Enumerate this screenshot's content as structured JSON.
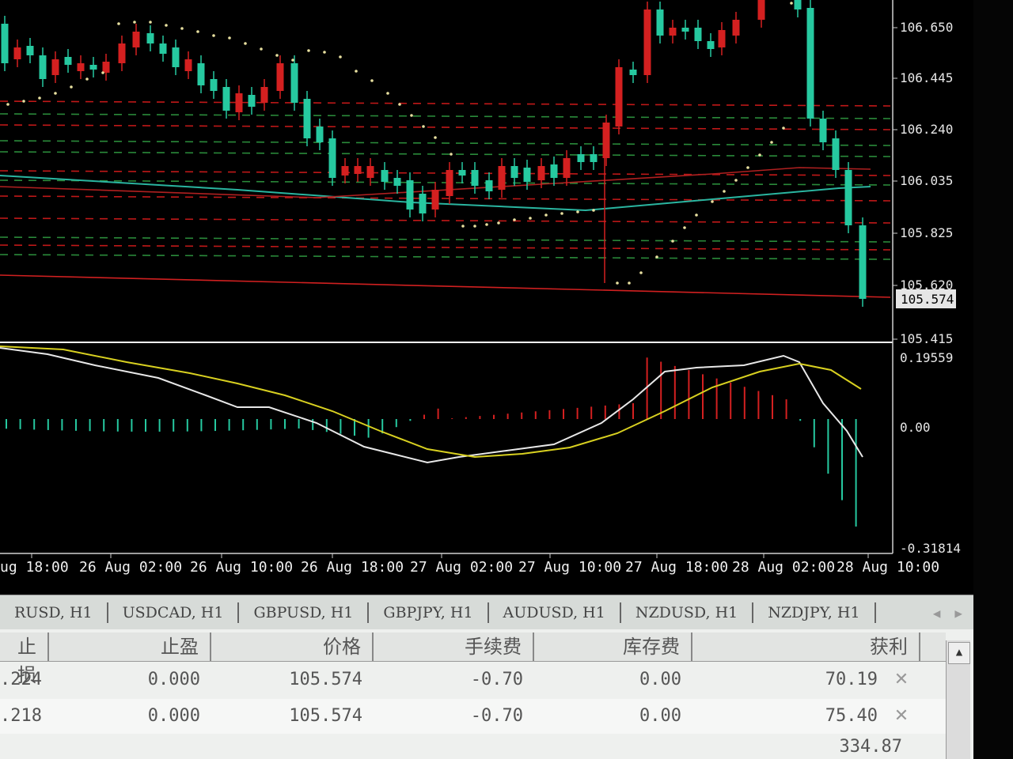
{
  "chart": {
    "price_axis": [
      "106.650",
      "106.445",
      "106.240",
      "106.035",
      "105.825",
      "105.620",
      "105.415"
    ],
    "current_price": "105.574",
    "macd_axis": [
      "0.19559",
      "0.00",
      "-0.31814"
    ],
    "time_axis": [
      "ug 18:00",
      "26 Aug 02:00",
      "26 Aug 10:00",
      "26 Aug 18:00",
      "27 Aug 02:00",
      "27 Aug 10:00",
      "27 Aug 18:00",
      "28 Aug 02:00",
      "28 Aug 10:00"
    ],
    "colors": {
      "bull": "#26c9a0",
      "bear": "#d42020",
      "macd_main": "#e8e8e8",
      "macd_signal": "#d8d020",
      "sar": "#e8e0a0",
      "grid_red": "#c01818",
      "grid_green": "#2a8a3a",
      "ma": "#2ab5a0"
    }
  },
  "tabs": [
    "RUSD, H1",
    "USDCAD, H1",
    "GBPUSD, H1",
    "GBPJPY, H1",
    "AUDUSD, H1",
    "NZDUSD, H1",
    "NZDJPY, H1"
  ],
  "orders": {
    "headers": {
      "sl": "止损",
      "tp": "止盈",
      "price": "价格",
      "fee": "手续费",
      "swap": "库存费",
      "profit": "获利"
    },
    "rows": [
      {
        "sl": ".224",
        "tp": "0.000",
        "price": "105.574",
        "fee": "-0.70",
        "swap": "0.00",
        "profit": "70.19"
      },
      {
        "sl": ".218",
        "tp": "0.000",
        "price": "105.574",
        "fee": "-0.70",
        "swap": "0.00",
        "profit": "75.40"
      }
    ],
    "total": "334.87"
  }
}
